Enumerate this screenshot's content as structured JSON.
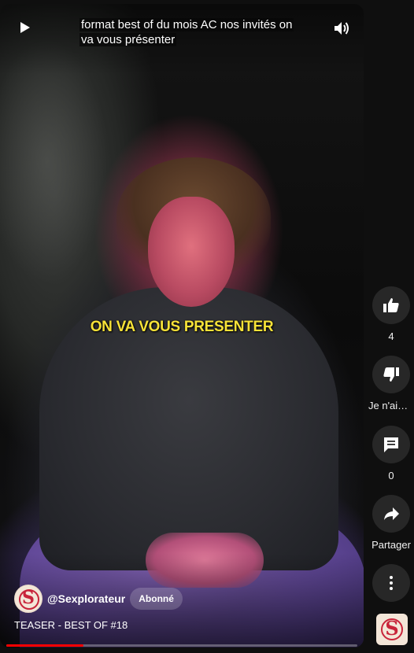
{
  "player": {
    "caption_line1": "format best of du mois AC nos invités on",
    "caption_line2": "va vous présenter",
    "subtitle": "ON VA VOUS PRESENTER",
    "icons": {
      "play": "play-icon",
      "volume": "volume-icon"
    },
    "progress_fraction": 0.22
  },
  "channel": {
    "handle": "@Sexplorateur",
    "subscribe_label": "Abonné",
    "avatar_letter": "S"
  },
  "video": {
    "title": "TEASER - BEST OF #18"
  },
  "actions": {
    "like_count": "4",
    "dislike_label": "Je n'aim…",
    "comment_count": "0",
    "share_label": "Partager"
  },
  "colors": {
    "accent": "#ff0000",
    "subtitle": "#f7e238",
    "brand": "#c8243a",
    "button_bg": "#272727"
  }
}
